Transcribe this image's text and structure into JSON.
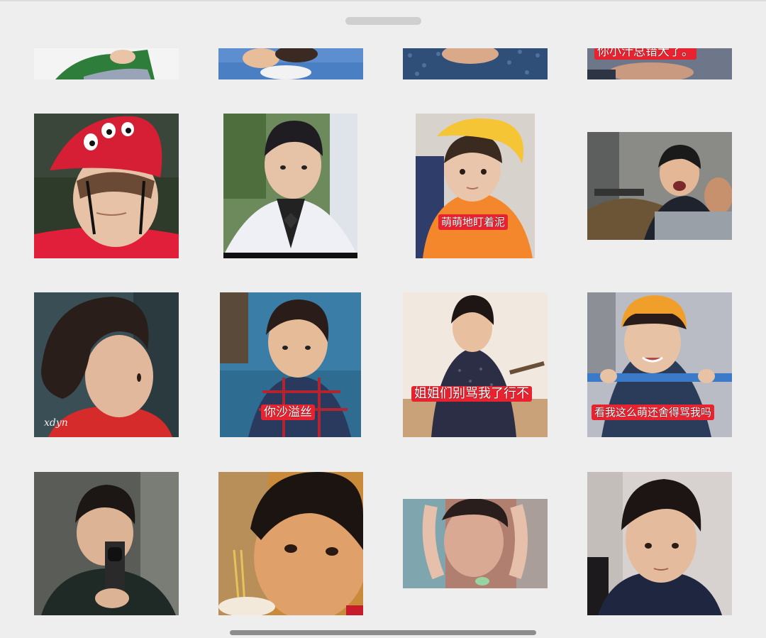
{
  "grid": {
    "row1": [
      {
        "id": "sticker-r1-1"
      },
      {
        "id": "sticker-r1-2"
      },
      {
        "id": "sticker-r1-3"
      },
      {
        "id": "sticker-r1-4",
        "caption": "你小汁总错大了。"
      }
    ],
    "row2": [
      {
        "id": "sticker-r2-1"
      },
      {
        "id": "sticker-r2-2"
      },
      {
        "id": "sticker-r2-3",
        "caption": "萌萌地盯着泥"
      },
      {
        "id": "sticker-r2-4"
      }
    ],
    "row3": [
      {
        "id": "sticker-r3-1",
        "watermark": "xdyn"
      },
      {
        "id": "sticker-r3-2",
        "caption": "你沙溢丝"
      },
      {
        "id": "sticker-r3-3",
        "caption": "姐姐们别骂我了行不"
      },
      {
        "id": "sticker-r3-4",
        "caption": "看我这么萌还舍得骂我吗"
      }
    ],
    "row4": [
      {
        "id": "sticker-r4-1"
      },
      {
        "id": "sticker-r4-2"
      },
      {
        "id": "sticker-r4-3"
      },
      {
        "id": "sticker-r4-4"
      }
    ]
  },
  "colors": {
    "background": "#eeeeee",
    "caption_bg": "#e8222f",
    "caption_text": "#ffffff",
    "handle": "#cfcfcf",
    "scrollbar": "#8c8c8c"
  },
  "icons": [
    "drag-handle",
    "scroll-indicator"
  ]
}
